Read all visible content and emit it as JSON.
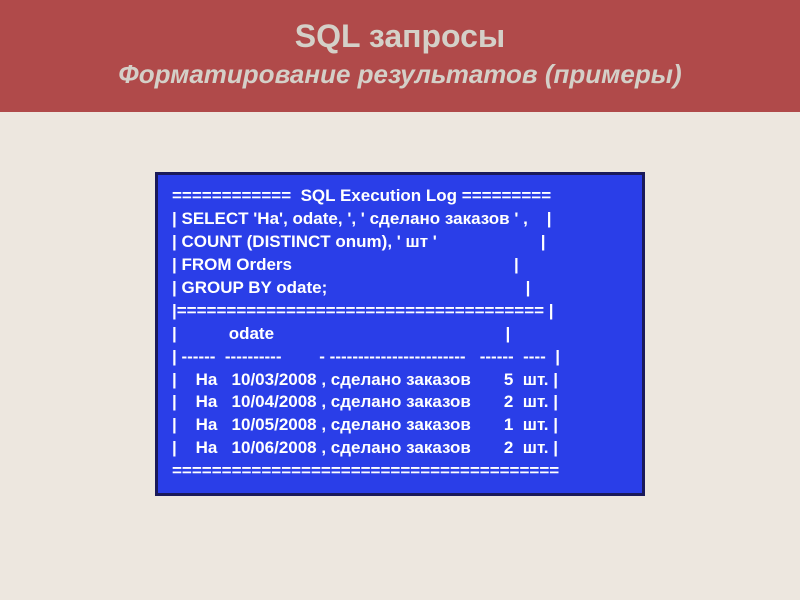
{
  "header": {
    "title": "SQL запросы",
    "subtitle": "Форматирование результатов (примеры)"
  },
  "code": {
    "lines": [
      "============  SQL Execution Log =========",
      "| SELECT 'На', odate, ', ' сделано заказов ' ,    |",
      "| COUNT (DISTINCT onum), ' шт '                      |",
      "| FROM Orders                                               |",
      "| GROUP BY odate;                                          |",
      "|===================================== |",
      "|           odate                                                 |",
      "| ------  ----------        - ------------------------   ------  ----  |",
      "|    На   10/03/2008 , сделано заказов       5  шт. |",
      "|    На   10/04/2008 , сделано заказов       2  шт. |",
      "|    На   10/05/2008 , сделано заказов       1  шт. |",
      "|    На   10/06/2008 , сделано заказов       2  шт. |",
      "======================================="
    ]
  }
}
